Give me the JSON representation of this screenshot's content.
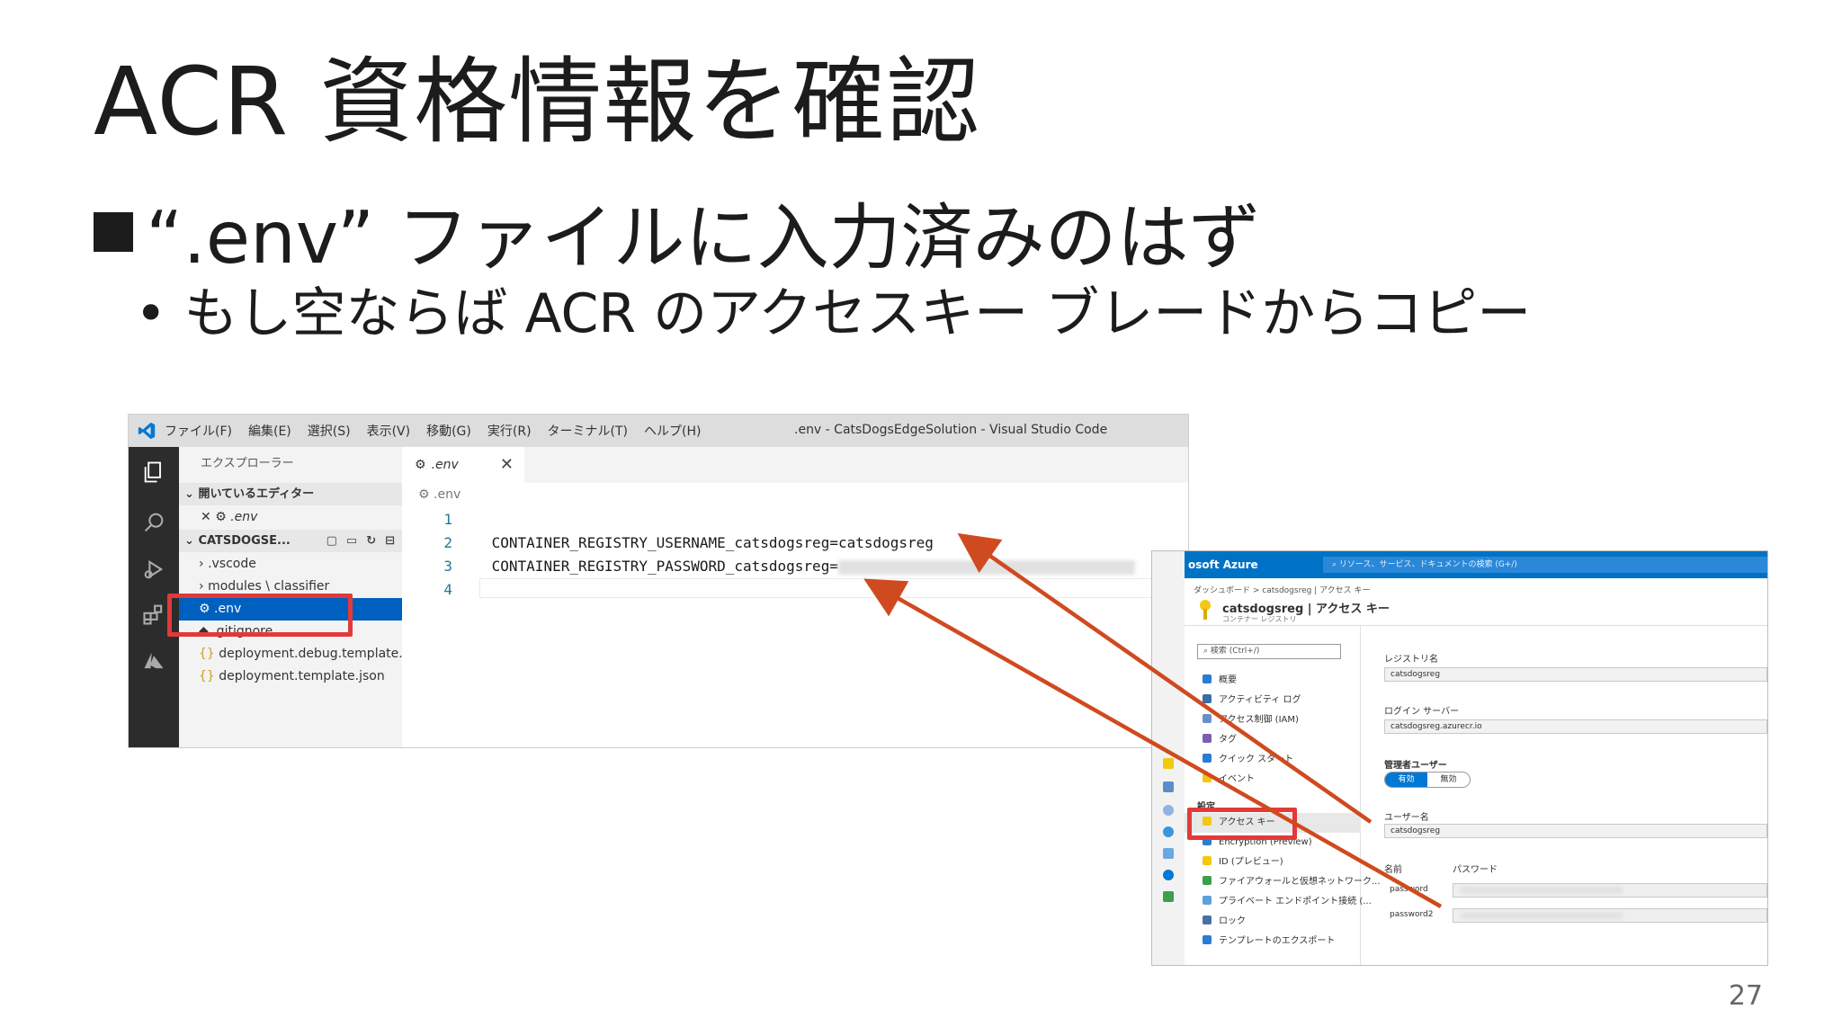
{
  "slide": {
    "title": "ACR 資格情報を確認",
    "bullet_main": "“.env” ファイルに入力済みのはず",
    "bullet_sub": "もし空ならば ACR のアクセスキー ブレードからコピー",
    "page_number": "27"
  },
  "vscode": {
    "menu": [
      "ファイル(F)",
      "編集(E)",
      "選択(S)",
      "表示(V)",
      "移動(G)",
      "実行(R)",
      "ターミナル(T)",
      "ヘルプ(H)"
    ],
    "window_title": ".env - CatsDogsEdgeSolution - Visual Studio Code",
    "explorer": {
      "header": "エクスプローラー",
      "open_editors": "開いているエディター",
      "open_file": ".env",
      "project": "CATSDOGSE...",
      "items": [
        ".vscode",
        "modules \\ classifier",
        ".env",
        ".gitignore",
        "deployment.debug.template...",
        "deployment.template.json"
      ]
    },
    "editor": {
      "tab": ".env",
      "breadcrumb": ".env",
      "line_numbers": [
        "1",
        "2",
        "3",
        "4"
      ],
      "line2": "CONTAINER_REGISTRY_USERNAME_catsdogsreg=catsdogsreg",
      "line3": "CONTAINER_REGISTRY_PASSWORD_catsdogsreg="
    }
  },
  "azure": {
    "brand": "osoft Azure",
    "search_placeholder": "リソース、サービス、ドキュメントの検索 (G+/)",
    "breadcrumb": "ダッシュボード > catsdogsreg | アクセス キー",
    "title": "catsdogsreg | アクセス キー",
    "subtitle": "コンテナー レジストリ",
    "nav_search": "検索 (Ctrl+/)",
    "nav": [
      "概要",
      "アクティビティ ログ",
      "アクセス制御 (IAM)",
      "タグ",
      "クイック スタート",
      "イベント"
    ],
    "settings_group": "設定",
    "settings_nav": [
      "アクセス キー",
      "Encryption (Preview)",
      "ID (プレビュー)",
      "ファイアウォールと仮想ネットワーク...",
      "プライベート エンドポイント接続 (...",
      "ロック",
      "テンプレートのエクスポート"
    ],
    "registry_name_label": "レジストリ名",
    "registry_name": "catsdogsreg",
    "login_server_label": "ログイン サーバー",
    "login_server": "catsdogsreg.azurecr.io",
    "admin_user_label": "管理者ユーザー",
    "toggle_on": "有効",
    "toggle_off": "無効",
    "username_label": "ユーザー名",
    "username": "catsdogsreg",
    "table_name_header": "名前",
    "table_password_header": "パスワード",
    "password_names": [
      "password",
      "password2"
    ]
  },
  "colors": {
    "highlight": "#e13a3a",
    "vscode_selection": "#0060c0",
    "azure_header": "#0072c6",
    "arrow": "#d04a1f"
  }
}
